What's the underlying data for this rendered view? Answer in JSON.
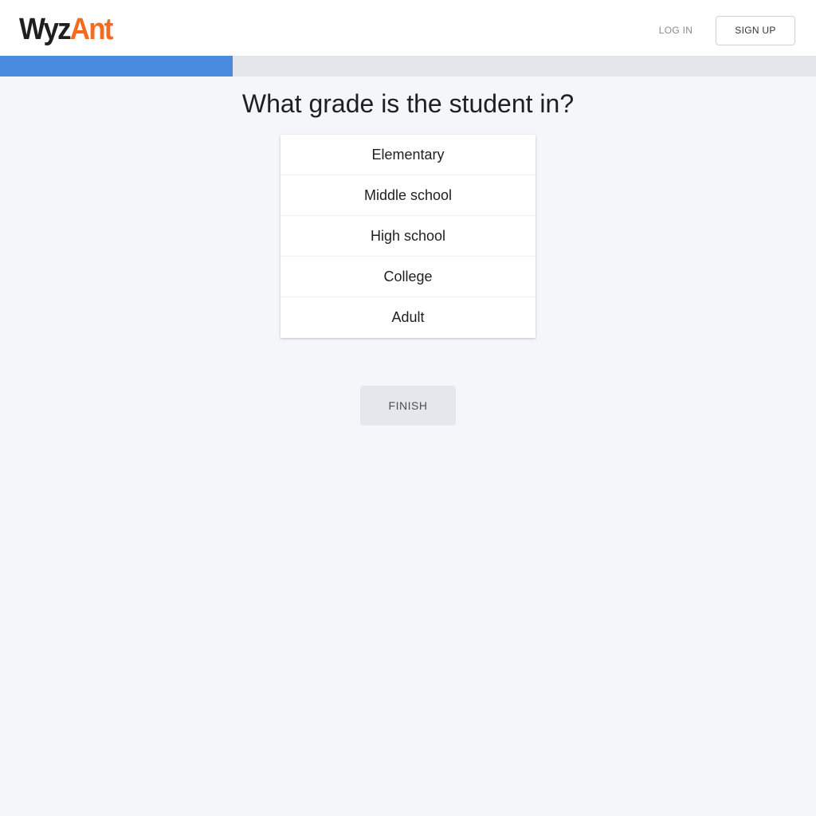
{
  "header": {
    "logo": {
      "part_a": "Wyz",
      "part_b": "Ant"
    },
    "login_label": "LOG IN",
    "signup_label": "SIGN UP"
  },
  "progress": {
    "fraction": 0.285,
    "fill_color": "#4a8adf"
  },
  "question": "What grade is the student in?",
  "options": [
    "Elementary",
    "Middle school",
    "High school",
    "College",
    "Adult"
  ],
  "finish_label": "FINISH",
  "colors": {
    "brand_orange": "#f26b21",
    "progress_blue": "#4a8adf",
    "background": "#f4f6fa"
  }
}
